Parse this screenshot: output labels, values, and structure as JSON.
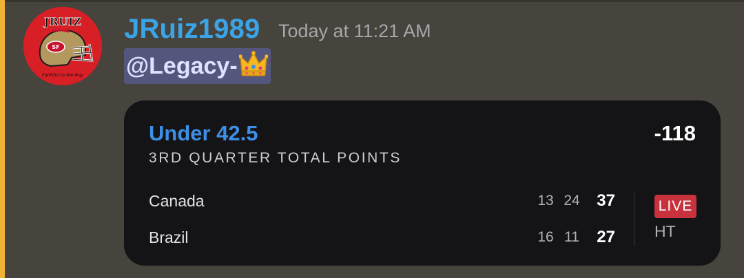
{
  "message": {
    "username": "JRuiz1989",
    "timestamp": "Today at 11:21 AM",
    "mention": "@Legacy-",
    "mention_emoji": "crown-emoji",
    "avatar": {
      "icon": "49ers-helmet-avatar",
      "top_text": "JRUIZ",
      "bottom_text": "Faithful to the Bay"
    }
  },
  "bet_card": {
    "selection": "Under 42.5",
    "odds": "-118",
    "market": "3RD QUARTER TOTAL POINTS",
    "teams": [
      {
        "name": "Canada",
        "q1": "13",
        "q2": "24",
        "total": "37"
      },
      {
        "name": "Brazil",
        "q1": "16",
        "q2": "11",
        "total": "27"
      }
    ],
    "live_label": "LIVE",
    "game_status": "HT"
  },
  "colors": {
    "background": "#47433d",
    "mention_highlight_bar": "#f0b232",
    "username": "#3aa4e6",
    "mention_bg": "#55567d",
    "card_bg": "#141416",
    "bet_title": "#3d8fe6",
    "live_badge": "#c8323d"
  }
}
